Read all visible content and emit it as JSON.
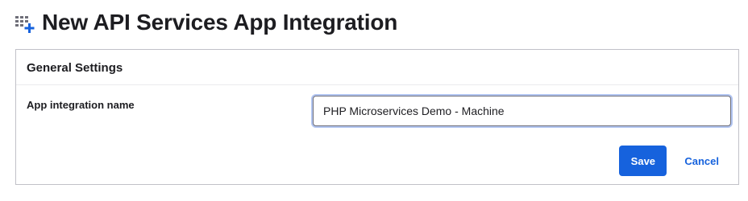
{
  "header": {
    "icon": "add-app-grid-icon",
    "title": "New API Services App Integration"
  },
  "general_settings": {
    "title": "General Settings",
    "app_name_label": "App integration name",
    "app_name_value": "PHP Microservices Demo - Machine"
  },
  "actions": {
    "save_label": "Save",
    "cancel_label": "Cancel"
  },
  "colors": {
    "primary": "#1662dd",
    "focus_ring": "#b3c6f2",
    "icon_grid": "#6e6e78",
    "icon_plus": "#1662dd"
  }
}
